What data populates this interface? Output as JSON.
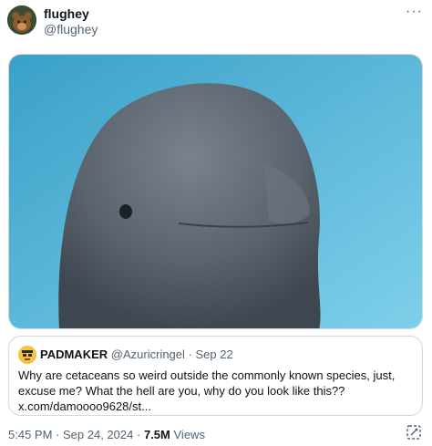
{
  "post": {
    "display_name": "flughey",
    "handle": "@flughey",
    "more_label": "···"
  },
  "media": {
    "alt": "Close-up photo of a beluga whale's head underwater",
    "background_color": "#4fb3d3",
    "subject_color": "#5d6670"
  },
  "quote": {
    "display_name": "PADMAKER",
    "handle": "@Azuricringel",
    "separator": "·",
    "date": "Sep 22",
    "text": "Why are cetaceans so weird outside the commonly known species, just, excuse me? What the hell are you, why do you look like this?? x.com/damoooo9628/st..."
  },
  "footer": {
    "time": "5:45 PM",
    "separator": "·",
    "date": "Sep 24, 2024",
    "views_count": "7.5M",
    "views_label": "Views"
  },
  "icons": {
    "more": "more-horizontal-icon",
    "grok": "grok-analyze-icon"
  }
}
